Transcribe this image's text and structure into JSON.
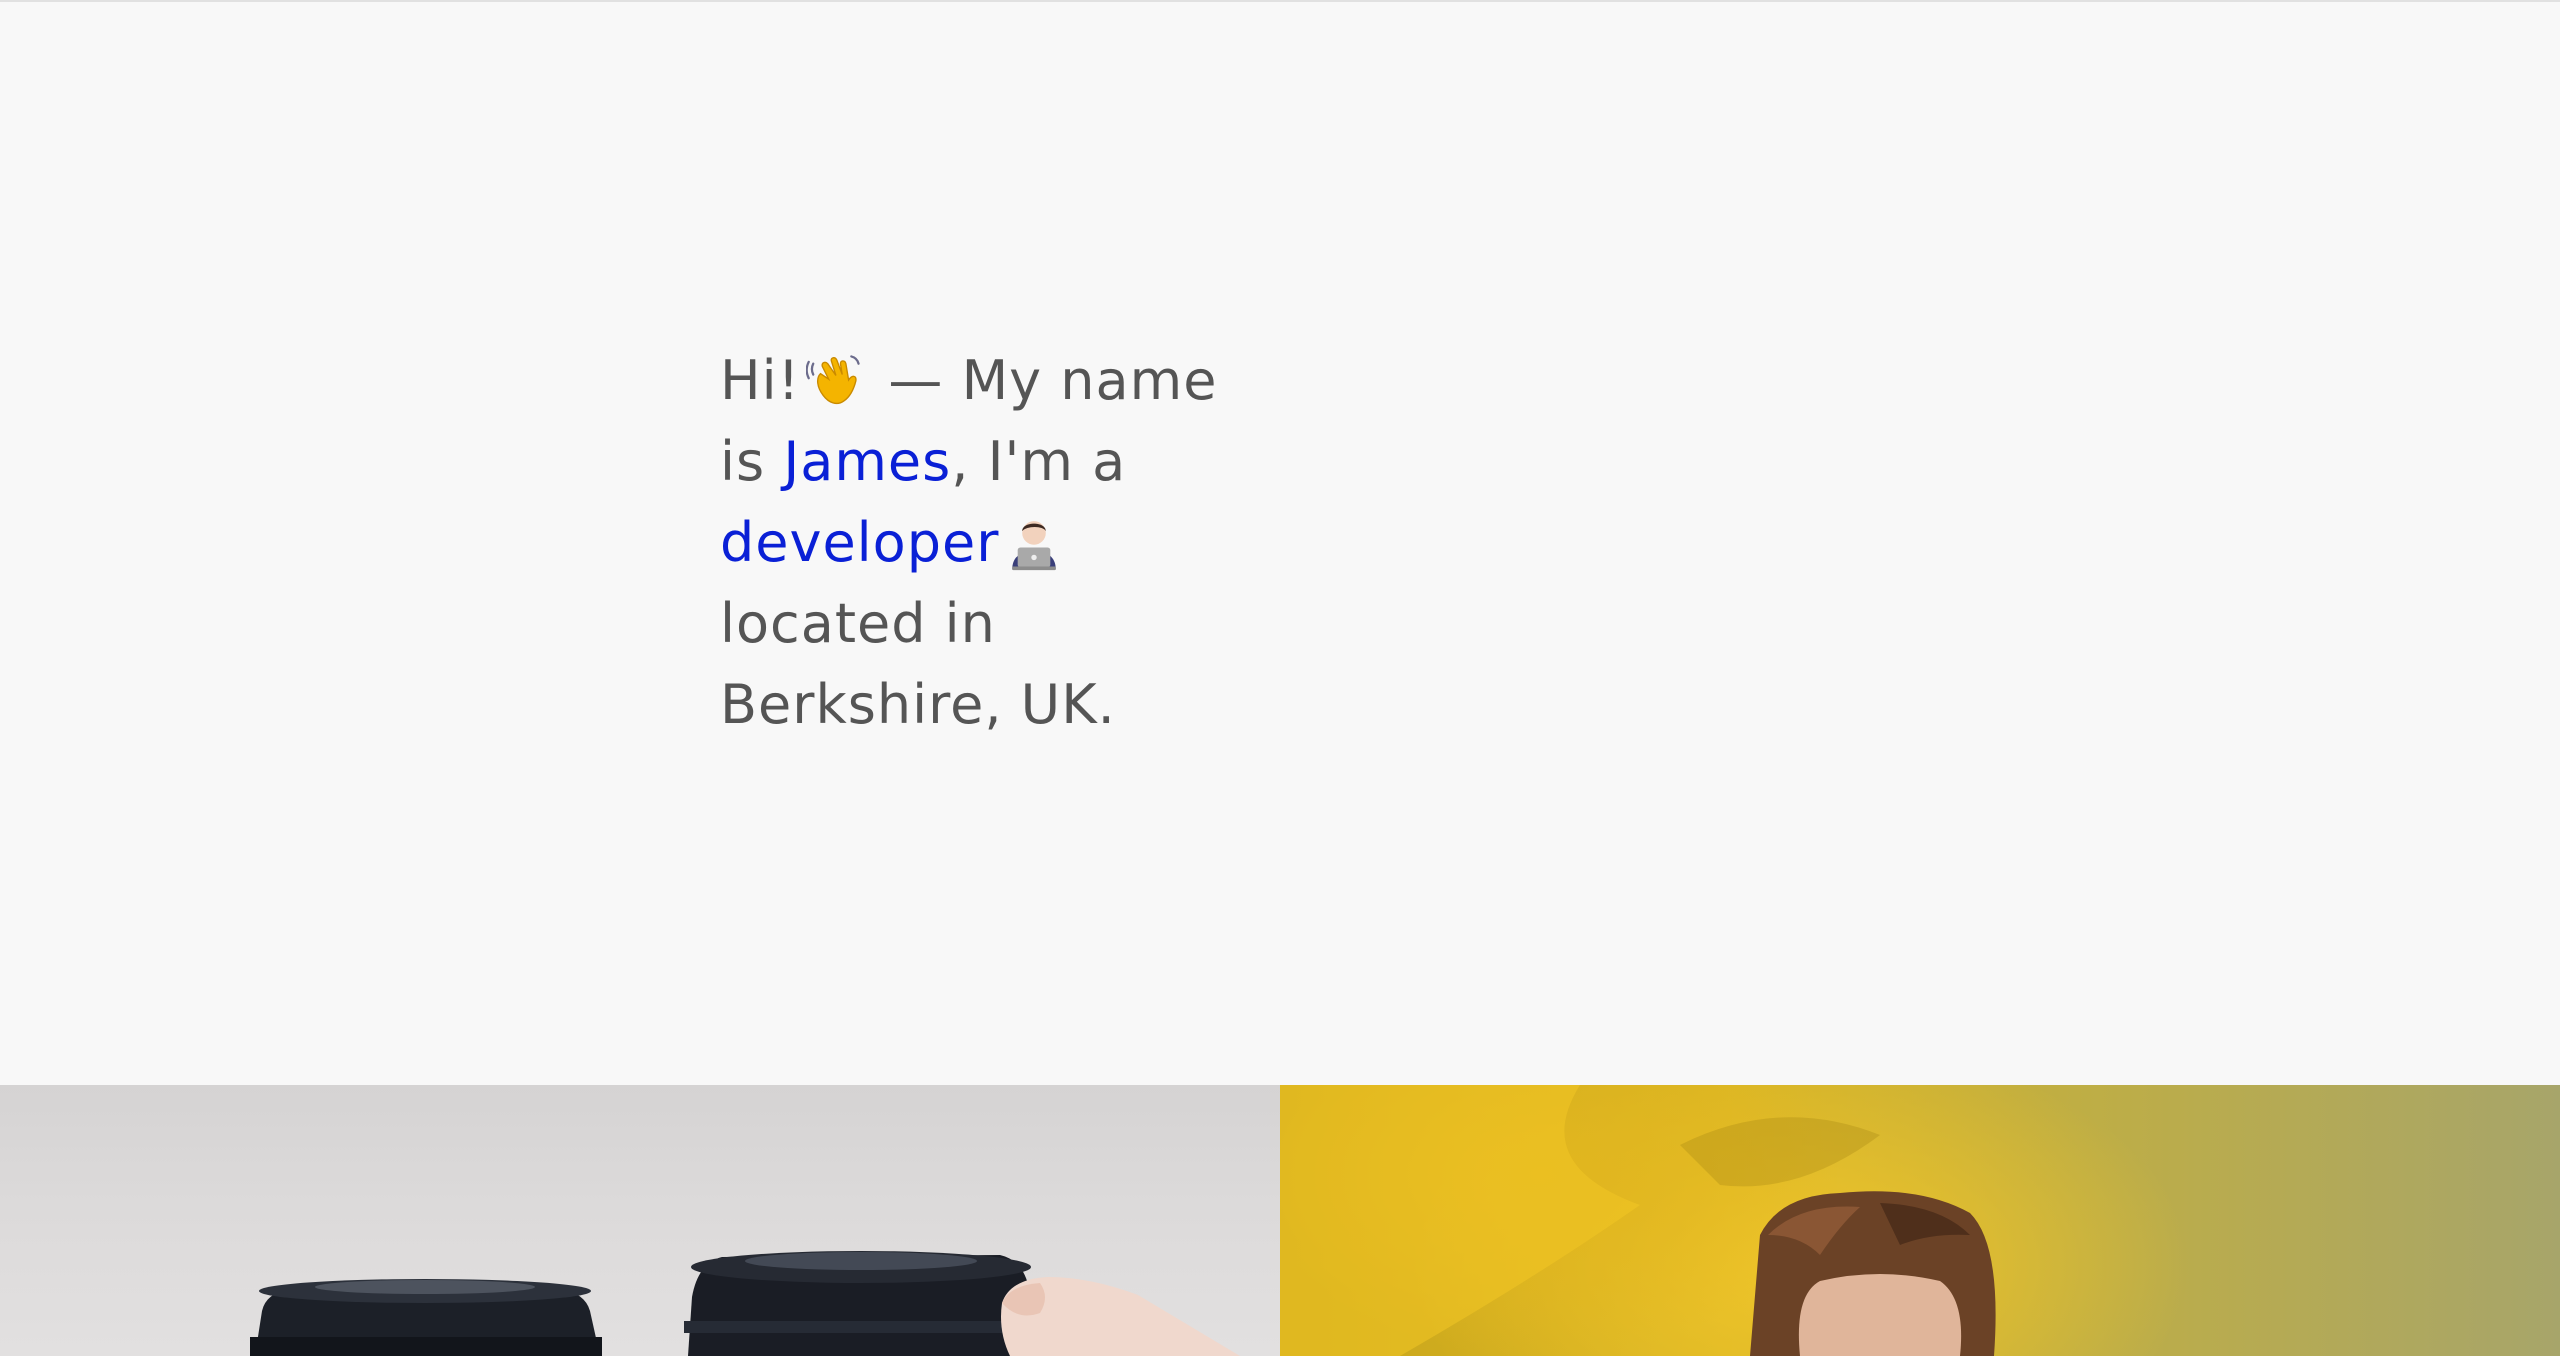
{
  "intro": {
    "greeting": "Hi!",
    "wave_emoji": "waving-hand",
    "dash": " — My name is ",
    "name_link": "James",
    "middle": ", I'm a ",
    "role_link": "developer",
    "laptop_emoji": "technologist",
    "location": "located in Berkshire, UK."
  },
  "gallery": {
    "tiles": [
      {
        "subject": "coffee-cups-photo"
      },
      {
        "subject": "yellow-smoke-portrait-photo"
      }
    ]
  },
  "colors": {
    "background": "#f8f8f8",
    "text": "#555555",
    "link": "#0a20d6",
    "smoke_yellow": "#e8c11f"
  }
}
